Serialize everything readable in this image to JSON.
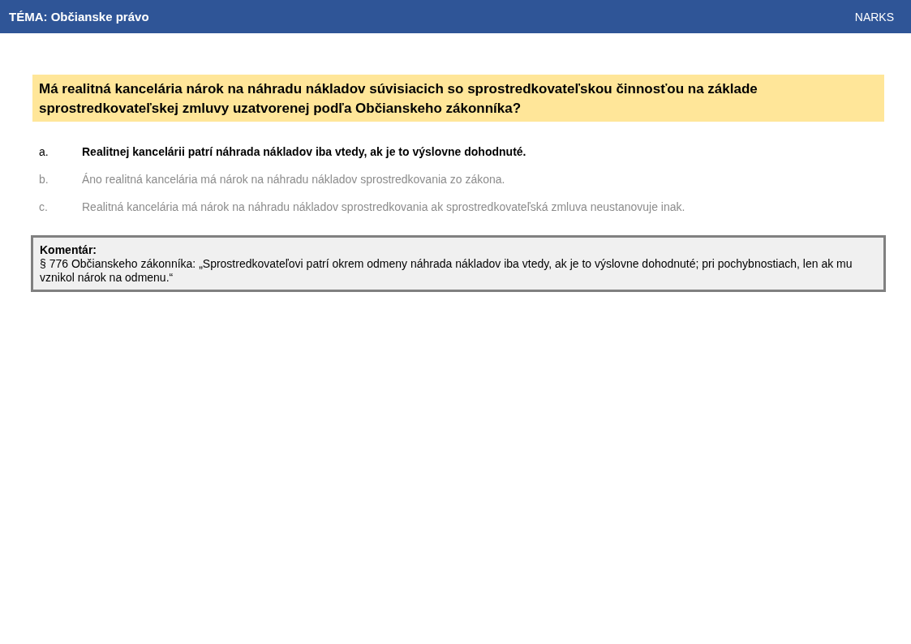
{
  "header": {
    "title": "TÉMA: Občianske právo",
    "brand": "NARKS"
  },
  "question": "Má realitná kancelária nárok na náhradu nákladov súvisiacich so sprostredkovateľskou činnosťou na základe sprostredkovateľskej zmluvy uzatvorenej podľa Občianskeho zákonníka?",
  "answers": [
    {
      "letter": "a.",
      "text": "Realitnej kancelárii patrí náhrada nákladov iba vtedy, ak je to výslovne dohodnuté.",
      "correct": true
    },
    {
      "letter": "b.",
      "text": "Áno realitná kancelária má nárok na náhradu nákladov sprostredkovania zo zákona.",
      "correct": false
    },
    {
      "letter": "c.",
      "text": "Realitná kancelária má nárok na náhradu nákladov sprostredkovania ak sprostredkovateľská zmluva neustanovuje inak.",
      "correct": false
    }
  ],
  "comment": {
    "heading": "Komentár:",
    "text": "§ 776 Občianskeho zákonníka: „Sprostredkovateľovi patrí okrem odmeny náhrada nákladov iba vtedy, ak je to výslovne dohodnuté; pri pochybnostiach, len ak mu vznikol nárok na odmenu.“"
  }
}
